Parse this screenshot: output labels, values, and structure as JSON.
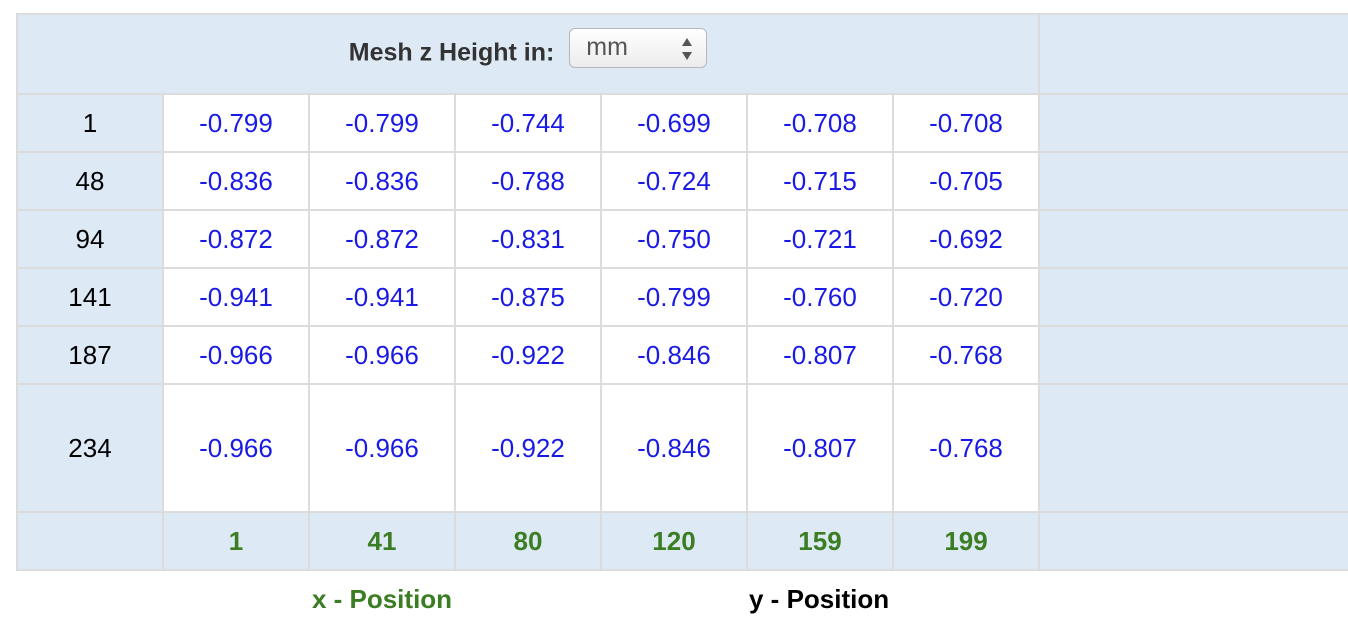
{
  "header": {
    "title": "Mesh z Height in:",
    "unit_select": {
      "selected": "mm"
    }
  },
  "y_positions": [
    "1",
    "48",
    "94",
    "141",
    "187",
    "234"
  ],
  "x_positions": [
    "1",
    "41",
    "80",
    "120",
    "159",
    "199"
  ],
  "values": [
    [
      "-0.799",
      "-0.799",
      "-0.744",
      "-0.699",
      "-0.708",
      "-0.708"
    ],
    [
      "-0.836",
      "-0.836",
      "-0.788",
      "-0.724",
      "-0.715",
      "-0.705"
    ],
    [
      "-0.872",
      "-0.872",
      "-0.831",
      "-0.750",
      "-0.721",
      "-0.692"
    ],
    [
      "-0.941",
      "-0.941",
      "-0.875",
      "-0.799",
      "-0.760",
      "-0.720"
    ],
    [
      "-0.966",
      "-0.966",
      "-0.922",
      "-0.846",
      "-0.807",
      "-0.768"
    ],
    [
      "-0.966",
      "-0.966",
      "-0.922",
      "-0.846",
      "-0.807",
      "-0.768"
    ]
  ],
  "axis_labels": {
    "x": "x - Position",
    "y": "y - Position"
  },
  "colors": {
    "header_bg": "#ddeaf6",
    "value_text": "#1a1ae6",
    "x_label": "#3b7d23"
  },
  "icons": {
    "unit_select_arrows": "up-down-arrows-icon"
  }
}
